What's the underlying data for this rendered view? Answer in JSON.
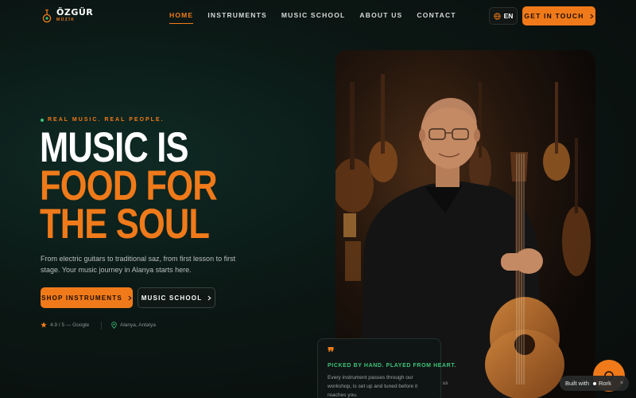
{
  "brand": {
    "name": "ÖZGÜR",
    "sub": "MÜZİK",
    "accent": "#f07a1a",
    "green": "#3fc37a"
  },
  "nav": {
    "items": [
      {
        "label": "HOME",
        "active": true
      },
      {
        "label": "INSTRUMENTS",
        "active": false
      },
      {
        "label": "MUSIC SCHOOL",
        "active": false
      },
      {
        "label": "ABOUT US",
        "active": false
      },
      {
        "label": "CONTACT",
        "active": false
      }
    ],
    "language": "EN",
    "cta_label": "GET IN TOUCH",
    "globe_icon": "globe-icon",
    "chevron_icon": "chevron-right-icon"
  },
  "hero": {
    "tagline": "REAL MUSIC. REAL PEOPLE.",
    "headline_line1": "MUSIC IS",
    "headline_line2": "FOOD FOR",
    "headline_line3": "THE SOUL",
    "description": "From electric guitars to traditional saz, from first lesson to first stage. Your music journey in Alanya starts here.",
    "primary_button": "SHOP INSTRUMENTS",
    "secondary_button": "MUSIC SCHOOL",
    "rating_text": "4.9 / 5 — Google",
    "location_text": "Alanya, Antalya"
  },
  "quote_card": {
    "icon": "quote-icon",
    "title": "PICKED BY HAND. PLAYED FROM HEART.",
    "text": "Every instrument passes through our workshop, is set up and tuned before it reaches you.",
    "peek": "us"
  },
  "badge": {
    "built_with": "Built with",
    "brand": "Rork",
    "close": "×"
  }
}
